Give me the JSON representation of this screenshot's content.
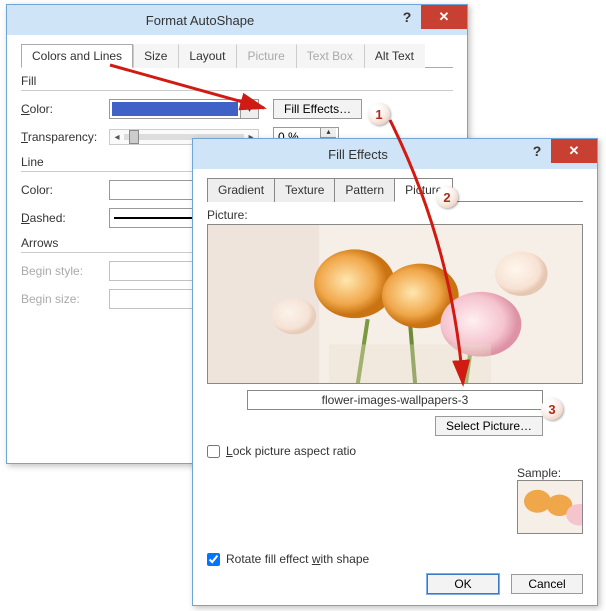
{
  "dlg1": {
    "title": "Format AutoShape",
    "help": "?",
    "close": "✕",
    "tabs": [
      "Colors and Lines",
      "Size",
      "Layout",
      "Picture",
      "Text Box",
      "Alt Text"
    ],
    "active_tab": "Colors and Lines",
    "disabled_tabs": [
      "Picture",
      "Text Box"
    ],
    "fill": {
      "header": "Fill",
      "color_label": "Color:",
      "color_hex": "#4061c6",
      "fill_effects_btn": "Fill Effects…",
      "transparency_label": "Transparency:",
      "transparency_value": "0 %"
    },
    "line": {
      "header": "Line",
      "color_label": "Color:",
      "dashed_label": "Dashed:"
    },
    "arrows": {
      "header": "Arrows",
      "begin_style_label": "Begin style:",
      "begin_size_label": "Begin size:"
    }
  },
  "dlg2": {
    "title": "Fill Effects",
    "help": "?",
    "close": "✕",
    "tabs": [
      "Gradient",
      "Texture",
      "Pattern",
      "Picture"
    ],
    "active_tab": "Picture",
    "picture_label": "Picture:",
    "picture_name": "flower-images-wallpapers-3",
    "select_btn": "Select Picture…",
    "lock_label": "Lock picture aspect ratio",
    "lock_checked": false,
    "sample_label": "Sample:",
    "rotate_label": "Rotate fill effect with shape",
    "rotate_checked": true,
    "ok": "OK",
    "cancel": "Cancel"
  },
  "callouts": {
    "c1": "1",
    "c2": "2",
    "c3": "3"
  }
}
